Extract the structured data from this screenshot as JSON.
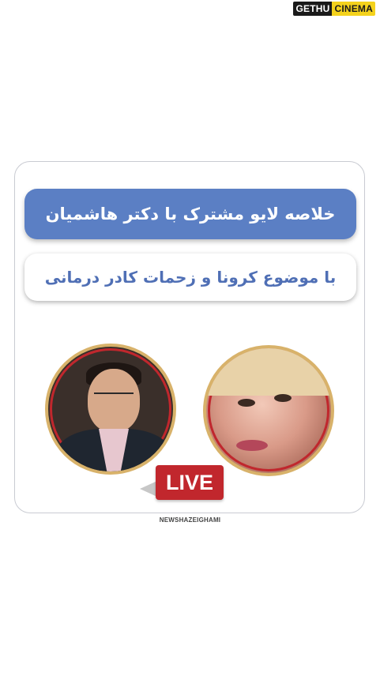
{
  "watermark": {
    "part1": "GETHU",
    "part2": "CINEMA"
  },
  "banner": {
    "title": "خلاصه لایو مشترک با دکتر هاشمیان",
    "subtitle": "با موضوع کرونا و زحمات کادر درمانی"
  },
  "live_label": "LIVE",
  "handle": "NEWSHAZEIGHAMI",
  "colors": {
    "banner_blue": "#5b7fc4",
    "live_red": "#c1272d",
    "ring_gold": "#d8b26a"
  }
}
